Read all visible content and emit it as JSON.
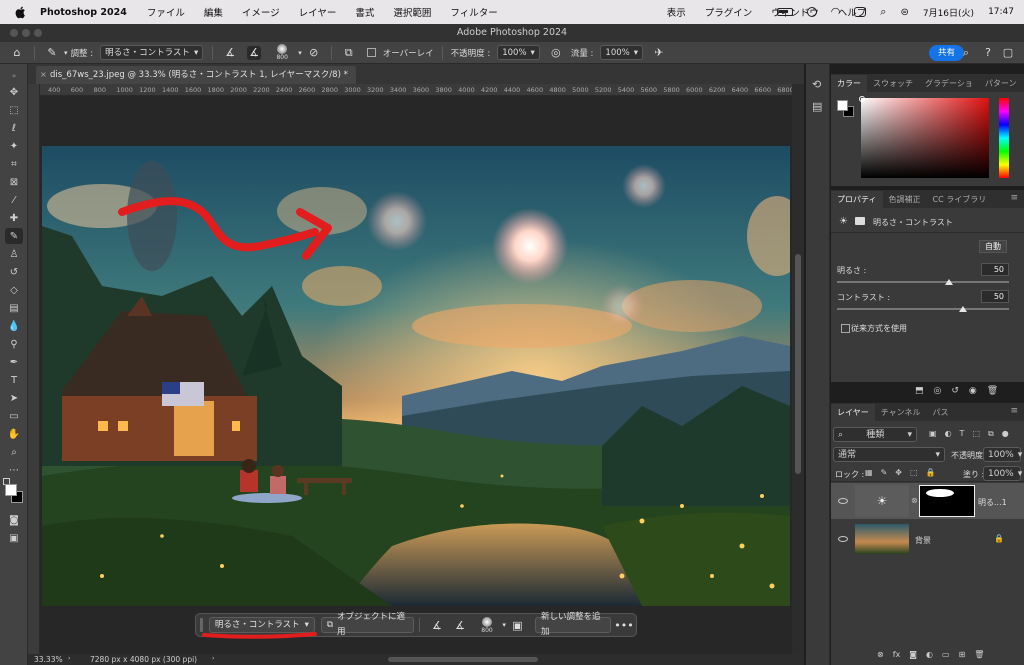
{
  "menubar": {
    "app": "Photoshop 2024",
    "items": [
      "ファイル",
      "編集",
      "イメージ",
      "レイヤー",
      "書式",
      "選択範囲",
      "フィルター",
      "表示",
      "プラグイン",
      "ウィンドウ",
      "ヘルプ"
    ],
    "date": "7月16日(火)",
    "time": "17:47"
  },
  "window": {
    "title": "Adobe Photoshop 2024"
  },
  "options": {
    "adjust_label": "調整 :",
    "adjust_value": "明るさ・コントラスト",
    "brush_size": "800",
    "overlay_label": "オーバーレイ",
    "opacity_label": "不透明度 :",
    "opacity_value": "100%",
    "flow_label": "流量 :",
    "flow_value": "100%",
    "share_label": "共有"
  },
  "document": {
    "tab_label": "dis_67ws_23.jpeg @ 33.3% (明るさ・コントラスト 1, レイヤーマスク/8) *",
    "ruler_ticks": [
      "400",
      "600",
      "800",
      "1000",
      "1200",
      "1400",
      "1600",
      "1800",
      "2000",
      "2200",
      "2400",
      "2600",
      "2800",
      "3000",
      "3200",
      "3400",
      "3600",
      "3800",
      "4000",
      "4200",
      "4400",
      "4600",
      "4800",
      "5000",
      "5200",
      "5400",
      "5600",
      "5800",
      "6000",
      "6200",
      "6400",
      "6600",
      "6800"
    ]
  },
  "contextbar": {
    "adjust_value": "明るさ・コントラスト",
    "apply_label": "オブジェクトに適用",
    "brush_size": "800",
    "new_adjust_label": "新しい調整を追加",
    "more": "•••"
  },
  "status": {
    "zoom": "33.33%",
    "info": "7280 px x 4080 px (300 ppi)"
  },
  "color_panel": {
    "tabs": [
      "カラー",
      "スウォッチ",
      "グラデーショ",
      "パターン"
    ]
  },
  "properties_panel": {
    "tabs": [
      "プロパティ",
      "色調補正",
      "CC ライブラリ"
    ],
    "header": "明るさ・コントラスト",
    "auto_label": "自動",
    "brightness_label": "明るさ :",
    "brightness_value": "50",
    "contrast_label": "コントラスト :",
    "contrast_value": "50",
    "legacy_label": "従来方式を使用"
  },
  "layers_panel": {
    "tabs": [
      "レイヤー",
      "チャンネル",
      "パス"
    ],
    "filter_label": "種類",
    "blend_mode": "通常",
    "opacity_label": "不透明度 :",
    "opacity_value": "100%",
    "lock_label": "ロック :",
    "fill_label": "塗り :",
    "fill_value": "100%",
    "layers": [
      {
        "name": "明る...1"
      },
      {
        "name": "背景"
      }
    ]
  },
  "annotations": {
    "arrow_color": "#e11d1d"
  },
  "colors": {
    "accent": "#1473e6",
    "panel": "#3a3a3a",
    "annotation": "#e11d1d"
  }
}
